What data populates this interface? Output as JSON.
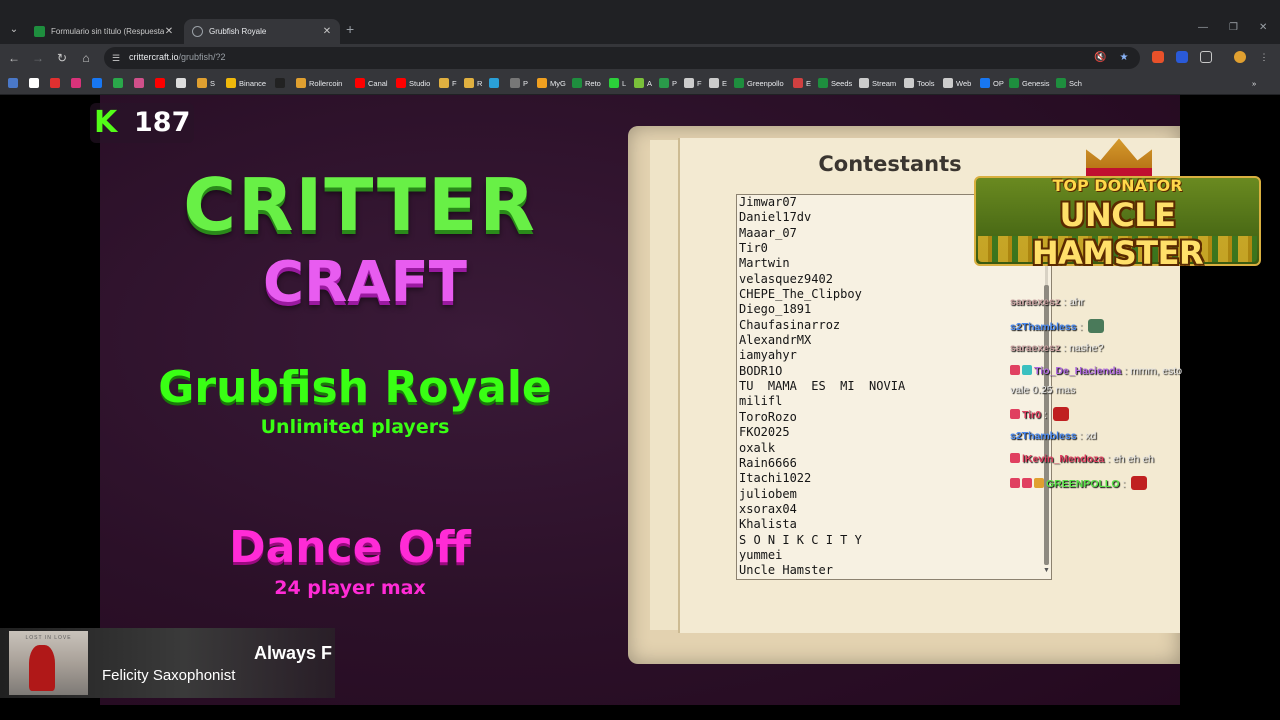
{
  "browser": {
    "tabs": [
      {
        "title": "Formulario sin título (Respuestas)",
        "close": "✕"
      },
      {
        "title": "Grubfish Royale",
        "close": "✕"
      }
    ],
    "new_tab": "+",
    "window_controls": [
      "—",
      "❐",
      "✕"
    ],
    "url_host": "crittercraft.io",
    "url_path": "/grubfish/?2",
    "bookmarks": [
      {
        "label": "",
        "color": "#4a78c8"
      },
      {
        "label": "",
        "color": "#ffffff"
      },
      {
        "label": "",
        "color": "#e03030"
      },
      {
        "label": "",
        "color": "#d8337a"
      },
      {
        "label": "",
        "color": "#1877f2"
      },
      {
        "label": "",
        "color": "#2aa84a"
      },
      {
        "label": "",
        "color": "#d0508a"
      },
      {
        "label": "",
        "color": "#ff0000"
      },
      {
        "label": "",
        "color": "#dddddd"
      },
      {
        "label": "S",
        "color": "#e0a030"
      },
      {
        "label": "Binance",
        "color": "#f0b90b"
      },
      {
        "label": "",
        "color": "#222222"
      },
      {
        "label": "Rollercoin",
        "color": "#e0a030"
      },
      {
        "label": "Canal",
        "color": "#ff0000"
      },
      {
        "label": "Studio",
        "color": "#ff0000"
      },
      {
        "label": "F",
        "color": "#e0b040"
      },
      {
        "label": "R",
        "color": "#e0b040"
      },
      {
        "label": "",
        "color": "#2aa0d8"
      },
      {
        "label": "P",
        "color": "#777777"
      },
      {
        "label": "MyG",
        "color": "#f0a020"
      },
      {
        "label": "Reto",
        "color": "#1e8e3e"
      },
      {
        "label": "L",
        "color": "#2bd03a"
      },
      {
        "label": "A",
        "color": "#7ac03a"
      },
      {
        "label": "P",
        "color": "#2a9a4a"
      },
      {
        "label": "F",
        "color": "#cccccc"
      },
      {
        "label": "E",
        "color": "#cccccc"
      },
      {
        "label": "Greenpollo",
        "color": "#1e8e3e"
      },
      {
        "label": "E",
        "color": "#d04040"
      },
      {
        "label": "Seeds",
        "color": "#1e8e3e"
      },
      {
        "label": "Stream",
        "color": "#cccccc"
      },
      {
        "label": "Tools",
        "color": "#cccccc"
      },
      {
        "label": "Web",
        "color": "#cccccc"
      },
      {
        "label": "OP",
        "color": "#1877f2"
      },
      {
        "label": "Genesis",
        "color": "#1e8e3e"
      },
      {
        "label": "Sch",
        "color": "#1e8e3e"
      }
    ],
    "bookmarks_more": "»"
  },
  "stream": {
    "viewer_logo": "K",
    "viewer_count": "187",
    "logo_line1": "CRITTER",
    "logo_line2": "CRAFT",
    "mode1_title": "Grubfish Royale",
    "mode1_subtitle": "Unlimited players",
    "mode2_title": "Dance Off",
    "mode2_subtitle": "24 player max",
    "book_title": "Contestants",
    "contestants": [
      "Jimwar07",
      "Daniel17dv",
      "Maaar_07",
      "Tir0",
      "Martwin",
      "velasquez9402",
      "CHEPE_The_Clipboy",
      "Diego_1891",
      "Chaufasinarroz",
      "AlexandrMX",
      "iamyahyr",
      "BODR1O",
      "TU  MAMA  ES  MI  NOVIA",
      "milifl",
      "ToroRozo",
      "FKO2025",
      "oxalk",
      "Rain6666",
      "Itachi1022",
      "juliobem",
      "xsorax04",
      "Khalista",
      "S O N I K C I T Y",
      "yummei",
      "Uncle Hamster"
    ],
    "scroll_arrow": "▼",
    "donator_label": "TOP DONATOR",
    "donator_name": "UNCLE HAMSTER"
  },
  "chat": {
    "separator": " : ",
    "messages": [
      {
        "user": "saraexesz",
        "user_color": "#c8a0a0",
        "text": "ahr"
      },
      {
        "user": "s2Thambless",
        "user_color": "#4a8af0",
        "text": ""
      },
      {
        "user": "saraexesz",
        "user_color": "#c8a0a0",
        "text": "nashe?"
      },
      {
        "user": "Tio_De_Hacienda",
        "user_color": "#b06ae0",
        "text": "mmm, esto"
      },
      {
        "user": "",
        "user_color": "#ffffff",
        "text": "vale 0.25 mas"
      },
      {
        "user": "Tir0",
        "user_color": "#e04060",
        "text": ""
      },
      {
        "user": "s2Thambless",
        "user_color": "#4a8af0",
        "text": "xd"
      },
      {
        "user": "lKevin_Mendoza",
        "user_color": "#e04060",
        "text": "eh eh eh"
      },
      {
        "user": "GREENPOLLO",
        "user_color": "#5ae04a",
        "text": ""
      }
    ]
  },
  "now_playing": {
    "title": "Always F",
    "artist": "Felicity Saxophonist",
    "art_caption": "LOST IN LOVE"
  }
}
